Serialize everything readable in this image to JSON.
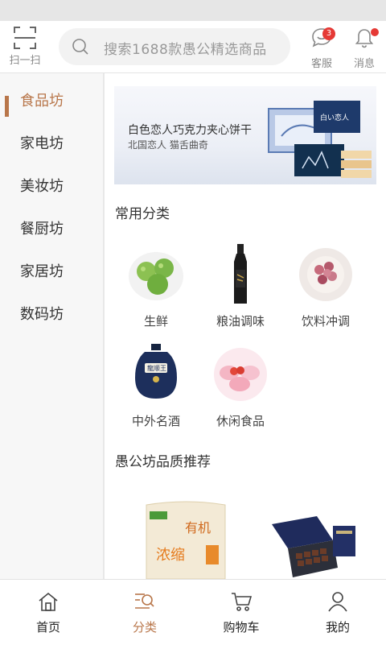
{
  "header": {
    "scan_label": "扫一扫",
    "search_placeholder": "搜索1688款愚公精选商品",
    "service_label": "客服",
    "service_badge": "3",
    "message_label": "消息"
  },
  "sidebar": {
    "items": [
      {
        "label": "食品坊",
        "active": true
      },
      {
        "label": "家电坊"
      },
      {
        "label": "美妆坊"
      },
      {
        "label": "餐厨坊"
      },
      {
        "label": "家居坊"
      },
      {
        "label": "数码坊"
      }
    ]
  },
  "banner": {
    "title": "白色恋人巧克力夹心饼干",
    "subtitle": "北国恋人 猫舌曲奇"
  },
  "common": {
    "title": "常用分类",
    "items": [
      {
        "label": "生鲜",
        "icon": "apple-icon"
      },
      {
        "label": "粮油调味",
        "icon": "oil-bottle-icon"
      },
      {
        "label": "饮料冲调",
        "icon": "flower-tea-icon"
      },
      {
        "label": "中外名酒",
        "icon": "liquor-jar-icon"
      },
      {
        "label": "休闲食品",
        "icon": "marshmallow-icon"
      }
    ]
  },
  "recommend": {
    "title": "愚公坊品质推荐",
    "yogurt_text": "有机",
    "yogurt_sub": "浓缩"
  },
  "tabbar": {
    "items": [
      {
        "label": "首页"
      },
      {
        "label": "分类",
        "active": true
      },
      {
        "label": "购物车"
      },
      {
        "label": "我的"
      }
    ]
  },
  "colors": {
    "accent": "#b8764a",
    "badge": "#e53935"
  }
}
